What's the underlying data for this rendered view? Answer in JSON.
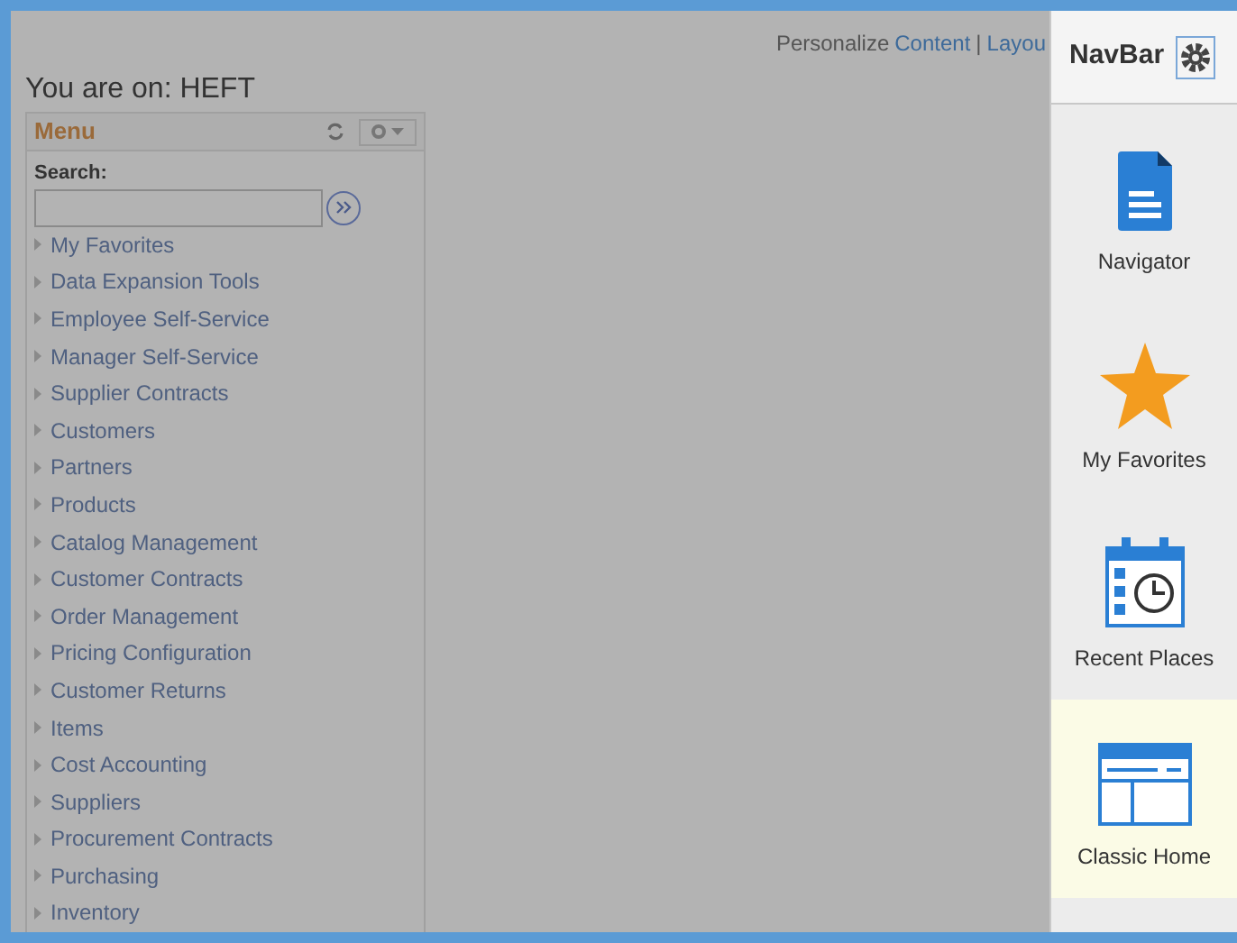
{
  "header": {
    "links": [
      {
        "text": "Personalize",
        "kind": "plain"
      },
      {
        "text": "Content",
        "kind": "link"
      },
      {
        "text": "|",
        "kind": "plain"
      },
      {
        "text": "Layou",
        "kind": "link"
      }
    ],
    "location": "You are on: HEFT"
  },
  "menu": {
    "title": "Menu",
    "search_label": "Search:",
    "items": [
      {
        "label": "My Favorites"
      },
      {
        "label": "Data Expansion Tools"
      },
      {
        "label": "Employee Self-Service"
      },
      {
        "label": "Manager Self-Service"
      },
      {
        "label": "Supplier Contracts"
      },
      {
        "label": "Customers"
      },
      {
        "label": "Partners"
      },
      {
        "label": "Products"
      },
      {
        "label": "Catalog Management"
      },
      {
        "label": "Customer Contracts"
      },
      {
        "label": "Order Management"
      },
      {
        "label": "Pricing Configuration"
      },
      {
        "label": "Customer Returns"
      },
      {
        "label": "Items"
      },
      {
        "label": "Cost Accounting"
      },
      {
        "label": "Suppliers"
      },
      {
        "label": "Procurement Contracts"
      },
      {
        "label": "Purchasing"
      },
      {
        "label": "Inventory"
      }
    ]
  },
  "navbar": {
    "title": "NavBar",
    "items": [
      {
        "label": "Navigator",
        "kind": "document",
        "selected": false
      },
      {
        "label": "My Favorites",
        "kind": "star",
        "selected": false
      },
      {
        "label": "Recent Places",
        "kind": "calendar",
        "selected": false
      },
      {
        "label": "Classic Home",
        "kind": "window",
        "selected": true
      }
    ]
  }
}
